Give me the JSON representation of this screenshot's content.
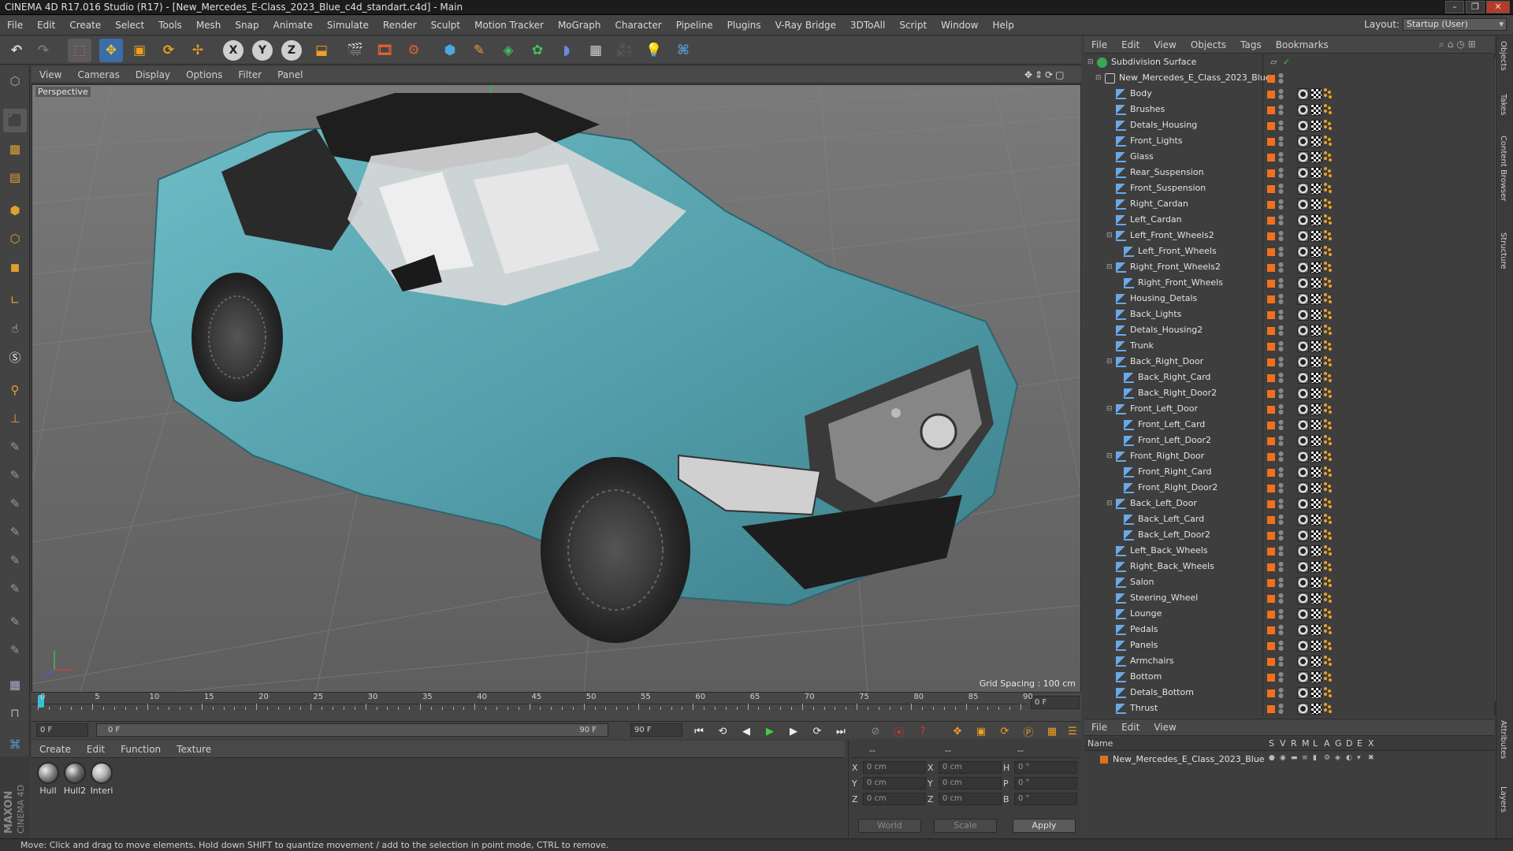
{
  "window": {
    "title": "CINEMA 4D R17.016 Studio (R17) - [New_Mercedes_E-Class_2023_Blue_c4d_standart.c4d] - Main"
  },
  "menubar": {
    "items": [
      "File",
      "Edit",
      "Create",
      "Select",
      "Tools",
      "Mesh",
      "Snap",
      "Animate",
      "Simulate",
      "Render",
      "Sculpt",
      "Motion Tracker",
      "MoGraph",
      "Character",
      "Pipeline",
      "Plugins",
      "V-Ray Bridge",
      "3DToAll",
      "Script",
      "Window",
      "Help"
    ]
  },
  "layout": {
    "label": "Layout:",
    "value": "Startup (User)"
  },
  "viewport": {
    "menu": [
      "View",
      "Cameras",
      "Display",
      "Options",
      "Filter",
      "Panel"
    ],
    "label": "Perspective",
    "grid_spacing": "Grid Spacing : 100 cm"
  },
  "timeline": {
    "ticks": [
      "0",
      "5",
      "10",
      "15",
      "20",
      "25",
      "30",
      "35",
      "40",
      "45",
      "50",
      "55",
      "60",
      "65",
      "70",
      "75",
      "80",
      "85",
      "90"
    ],
    "current_frame": "0 F",
    "start_field": "0 F",
    "range_start": "0 F",
    "range_end": "90 F",
    "end_field": "90 F"
  },
  "material_manager": {
    "menu": [
      "Create",
      "Edit",
      "Function",
      "Texture"
    ],
    "materials": [
      {
        "name": "Hull",
        "color": "#8a8a8a"
      },
      {
        "name": "Hull2",
        "color": "#6e6e6e"
      },
      {
        "name": "Interi",
        "color": "#b0b0b0"
      }
    ]
  },
  "coordinates": {
    "header": [
      "--",
      "--",
      "--"
    ],
    "rows": [
      {
        "a": "X",
        "a_val": "0 cm",
        "b": "X",
        "b_val": "0 cm",
        "c": "H",
        "c_val": "0 °"
      },
      {
        "a": "Y",
        "a_val": "0 cm",
        "b": "Y",
        "b_val": "0 cm",
        "c": "P",
        "c_val": "0 °"
      },
      {
        "a": "Z",
        "a_val": "0 cm",
        "b": "Z",
        "b_val": "0 cm",
        "c": "B",
        "c_val": "0 °"
      }
    ],
    "mode": "World",
    "transform": "Scale",
    "apply": "Apply"
  },
  "status": "Move: Click and drag to move elements. Hold down SHIFT to quantize movement / add to the selection in point mode, CTRL to remove.",
  "object_manager": {
    "menu": [
      "File",
      "Edit",
      "View",
      "Objects",
      "Tags",
      "Bookmarks"
    ],
    "objects": [
      {
        "name": "Subdivision Surface",
        "level": 0,
        "type": "subd"
      },
      {
        "name": "New_Mercedes_E_Class_2023_Blue",
        "level": 1,
        "type": "null"
      },
      {
        "name": "Body",
        "level": 2
      },
      {
        "name": "Brushes",
        "level": 2
      },
      {
        "name": "Detals_Housing",
        "level": 2
      },
      {
        "name": "Front_Lights",
        "level": 2
      },
      {
        "name": "Glass",
        "level": 2
      },
      {
        "name": "Rear_Suspension",
        "level": 2
      },
      {
        "name": "Front_Suspension",
        "level": 2
      },
      {
        "name": "Right_Cardan",
        "level": 2
      },
      {
        "name": "Left_Cardan",
        "level": 2
      },
      {
        "name": "Left_Front_Wheels2",
        "level": 2,
        "open": true
      },
      {
        "name": "Left_Front_Wheels",
        "level": 3
      },
      {
        "name": "Right_Front_Wheels2",
        "level": 2,
        "open": true
      },
      {
        "name": "Right_Front_Wheels",
        "level": 3
      },
      {
        "name": "Housing_Detals",
        "level": 2
      },
      {
        "name": "Back_Lights",
        "level": 2
      },
      {
        "name": "Detals_Housing2",
        "level": 2
      },
      {
        "name": "Trunk",
        "level": 2
      },
      {
        "name": "Back_Right_Door",
        "level": 2,
        "open": true
      },
      {
        "name": "Back_Right_Card",
        "level": 3
      },
      {
        "name": "Back_Right_Door2",
        "level": 3
      },
      {
        "name": "Front_Left_Door",
        "level": 2,
        "open": true
      },
      {
        "name": "Front_Left_Card",
        "level": 3
      },
      {
        "name": "Front_Left_Door2",
        "level": 3
      },
      {
        "name": "Front_Right_Door",
        "level": 2,
        "open": true
      },
      {
        "name": "Front_Right_Card",
        "level": 3
      },
      {
        "name": "Front_Right_Door2",
        "level": 3
      },
      {
        "name": "Back_Left_Door",
        "level": 2,
        "open": true
      },
      {
        "name": "Back_Left_Card",
        "level": 3
      },
      {
        "name": "Back_Left_Door2",
        "level": 3
      },
      {
        "name": "Left_Back_Wheels",
        "level": 2
      },
      {
        "name": "Right_Back_Wheels",
        "level": 2
      },
      {
        "name": "Salon",
        "level": 2
      },
      {
        "name": "Steering_Wheel",
        "level": 2
      },
      {
        "name": "Lounge",
        "level": 2
      },
      {
        "name": "Pedals",
        "level": 2
      },
      {
        "name": "Panels",
        "level": 2
      },
      {
        "name": "Armchairs",
        "level": 2
      },
      {
        "name": "Bottom",
        "level": 2
      },
      {
        "name": "Detals_Bottom",
        "level": 2
      },
      {
        "name": "Thrust",
        "level": 2
      }
    ]
  },
  "side_tabs": [
    "Objects",
    "Takes",
    "Content Browser",
    "Structure"
  ],
  "side_tabs_lower": [
    "Attributes",
    "Layers"
  ],
  "layer_manager": {
    "menu": [
      "File",
      "Edit",
      "View"
    ],
    "columns": [
      "Name",
      "S",
      "V",
      "R",
      "M",
      "L",
      "A",
      "G",
      "D",
      "E",
      "X"
    ],
    "layers": [
      {
        "name": "New_Mercedes_E_Class_2023_Blue",
        "color": "#e07020"
      }
    ]
  },
  "branding": {
    "line1": "MAXON",
    "line2": "CINEMA 4D"
  },
  "colors": {
    "accent": "#f07020",
    "car": "#5aa8b4",
    "grid": "#6a6a6a"
  }
}
